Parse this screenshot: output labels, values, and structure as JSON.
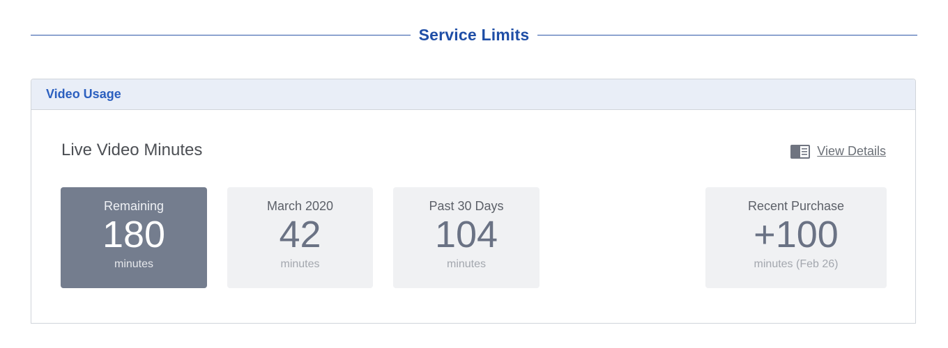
{
  "section": {
    "title": "Service Limits"
  },
  "panel": {
    "header": "Video Usage",
    "card_title": "Live Video Minutes",
    "view_details": "View Details",
    "view_details_icon": "book-icon"
  },
  "stats": {
    "remaining": {
      "label": "Remaining",
      "value": "180",
      "unit": "minutes"
    },
    "month": {
      "label": "March 2020",
      "value": "42",
      "unit": "minutes"
    },
    "past30": {
      "label": "Past 30 Days",
      "value": "104",
      "unit": "minutes"
    },
    "purchase": {
      "label": "Recent Purchase",
      "value": "+100",
      "unit": "minutes (Feb 26)"
    }
  },
  "colors": {
    "accent": "#1f4ea6",
    "header_bg": "#e9eef7",
    "active_tile": "#747d8e",
    "tile": "#f0f1f3"
  }
}
